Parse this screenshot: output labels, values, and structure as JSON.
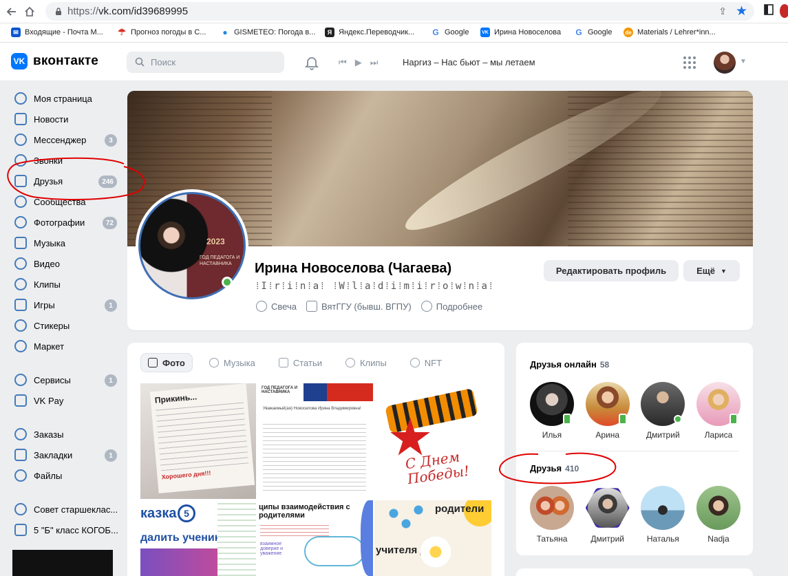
{
  "browser": {
    "url_prefix": "https://",
    "url_host": "vk.com/id39689995",
    "bookmarks": [
      {
        "label": "Входящие - Почта M...",
        "color": "#0b57d0",
        "glyph": "✉"
      },
      {
        "label": "Прогноз погоды в С...",
        "color": "#d93025",
        "glyph": "☂"
      },
      {
        "label": "GISMETEO: Погода в...",
        "color": "#1e88e5",
        "glyph": "💧"
      },
      {
        "label": "Яндекс.Переводчик...",
        "color": "#222222",
        "glyph": "Я"
      },
      {
        "label": "Google",
        "color": "#4285f4",
        "glyph": "G"
      },
      {
        "label": "Ирина Новоселова",
        "color": "#0077ff",
        "glyph": "VK"
      },
      {
        "label": "Google",
        "color": "#4285f4",
        "glyph": "G"
      },
      {
        "label": "Materials / Lehrer*inn...",
        "color": "#f29900",
        "glyph": "de"
      }
    ]
  },
  "header": {
    "logo_mark": "VK",
    "logo_text": "вконтакте",
    "search_placeholder": "Поиск",
    "now_playing": "Наргиз – Нас бьют – мы летаем"
  },
  "sidebar": {
    "items": [
      {
        "label": "Моя страница",
        "badge": ""
      },
      {
        "label": "Новости",
        "badge": ""
      },
      {
        "label": "Мессенджер",
        "badge": "3"
      },
      {
        "label": "Звонки",
        "badge": ""
      },
      {
        "label": "Друзья",
        "badge": "246"
      },
      {
        "label": "Сообщества",
        "badge": ""
      },
      {
        "label": "Фотографии",
        "badge": "72"
      },
      {
        "label": "Музыка",
        "badge": ""
      },
      {
        "label": "Видео",
        "badge": ""
      },
      {
        "label": "Клипы",
        "badge": ""
      },
      {
        "label": "Игры",
        "badge": "1"
      },
      {
        "label": "Стикеры",
        "badge": ""
      },
      {
        "label": "Маркет",
        "badge": ""
      }
    ],
    "items2": [
      {
        "label": "Сервисы",
        "badge": "1"
      },
      {
        "label": "VK Pay",
        "badge": ""
      }
    ],
    "items3": [
      {
        "label": "Заказы",
        "badge": ""
      },
      {
        "label": "Закладки",
        "badge": "1"
      },
      {
        "label": "Файлы",
        "badge": ""
      }
    ],
    "items4": [
      {
        "label": "Совет старшеклас...",
        "badge": ""
      },
      {
        "label": "5 \"Б\" класс КОГОБ...",
        "badge": ""
      }
    ]
  },
  "profile": {
    "name": "Ирина Новоселова (Чагаева)",
    "status": "🇮︎r︎i︎n︎a W︎l︎a︎d︎i︎m︎i︎r︎o︎w︎n︎a",
    "status_display": "⁞I⁞r⁞i⁞n⁞a⁞ ⁞W⁞l⁞a⁞d⁞i⁞m⁞i⁞r⁞o⁞w⁞n⁞a⁞",
    "city": "Свеча",
    "education": "ВятГГУ (бывш. ВГПУ)",
    "more_info": "Подробнее",
    "edit_button": "Редактировать профиль",
    "more_button": "Ещё",
    "avatar_year": "2023",
    "avatar_caption": "ГОД ПЕДАГОГА И НАСТАВНИКА"
  },
  "media": {
    "tabs": [
      "Фото",
      "Музыка",
      "Статьи",
      "Клипы",
      "NFT"
    ],
    "photos": [
      {
        "title": "Прикинь...",
        "caption": "Хорошего дня!!!"
      },
      {
        "title": "ГОД ПЕДАГОГА И НАСТАВНИКА",
        "caption": "Уважаемый(ая) Новоселова Ирина Владимировна!"
      },
      {
        "title": "С Днем Победы!",
        "caption": ""
      },
      {
        "title": "казка",
        "caption": "далить ученика"
      },
      {
        "title": "ципы взаимодействия с родителями",
        "caption": "взаимное доверие и уважение"
      },
      {
        "title": "родители",
        "caption": "учителя дети"
      }
    ]
  },
  "friends": {
    "online_title": "Друзья онлайн",
    "online_count": "58",
    "online": [
      {
        "name": "Илья",
        "indicator": "mobile"
      },
      {
        "name": "Арина",
        "indicator": "mobile"
      },
      {
        "name": "Дмитрий",
        "indicator": "dot"
      },
      {
        "name": "Лариса",
        "indicator": "mobile"
      }
    ],
    "all_title": "Друзья",
    "all_count": "410",
    "all": [
      {
        "name": "Татьяна"
      },
      {
        "name": "Дмитрий"
      },
      {
        "name": "Наталья"
      },
      {
        "name": "Nadja"
      }
    ]
  },
  "colors": {
    "accent": "#0077ff",
    "link": "#2a5885",
    "online": "#4bb34b",
    "annotation": "#e00000"
  }
}
